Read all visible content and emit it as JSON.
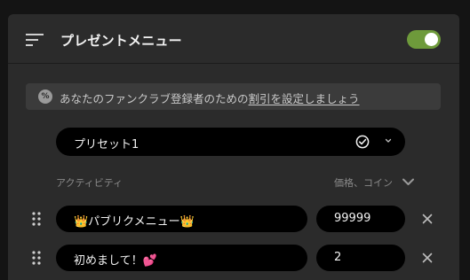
{
  "header": {
    "title": "プレゼントメニュー",
    "menu_icon": "sort-lines-icon",
    "toggle": {
      "state": "on",
      "color": "#6e9a3b"
    }
  },
  "banner": {
    "icon_text": "%",
    "text": "あなたのファンクラブ登録者のための",
    "link": "割引を設定しましょう"
  },
  "preset": {
    "label": "プリセット1",
    "icons": [
      "check-circle-icon",
      "chevron-down-icon"
    ]
  },
  "columns": {
    "activity": "アクティビティ",
    "price": "価格、コイン"
  },
  "rows": [
    {
      "activity": "👑パブリクメニュー👑",
      "price": "99999"
    },
    {
      "activity": "初めまして！💕",
      "price": "2"
    }
  ],
  "colors": {
    "panel": "#2b2b2b",
    "field": "#000000",
    "accent": "#6e9a3b"
  }
}
